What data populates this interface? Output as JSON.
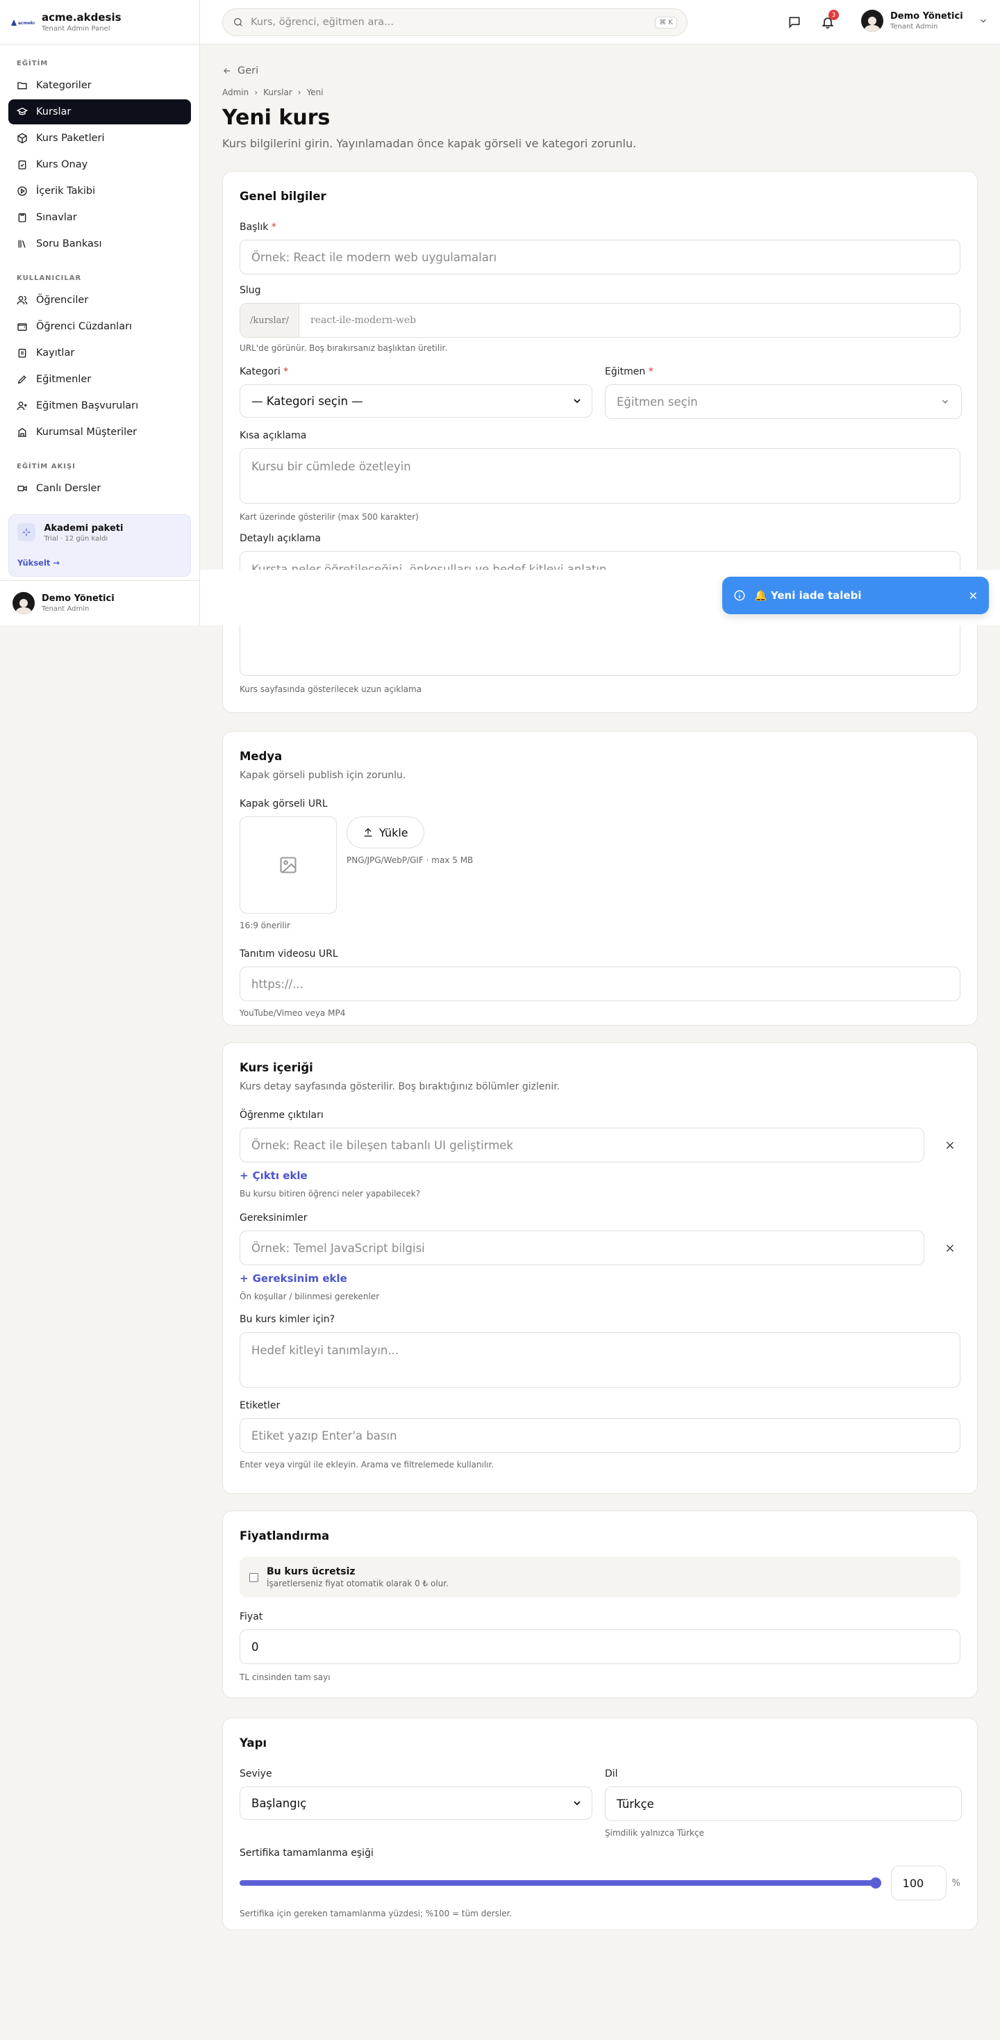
{
  "brand": {
    "logo": "acmekdx",
    "name": "acme.akdesis",
    "sub": "Tenant Admin Panel"
  },
  "sidebar": {
    "sections": [
      {
        "title": "EĞİTİM",
        "items": [
          {
            "label": "Kategoriler",
            "icon": "folder-icon"
          },
          {
            "label": "Kurslar",
            "icon": "graduation-cap-icon",
            "active": true
          },
          {
            "label": "Kurs Paketleri",
            "icon": "package-icon"
          },
          {
            "label": "Kurs Onay",
            "icon": "clipboard-check-icon"
          },
          {
            "label": "İçerik Takibi",
            "icon": "play-circle-icon"
          },
          {
            "label": "Sınavlar",
            "icon": "clipboard-icon"
          },
          {
            "label": "Soru Bankası",
            "icon": "library-icon"
          }
        ]
      },
      {
        "title": "KULLANICILAR",
        "items": [
          {
            "label": "Öğrenciler",
            "icon": "users-icon"
          },
          {
            "label": "Öğrenci Cüzdanları",
            "icon": "wallet-icon"
          },
          {
            "label": "Kayıtlar",
            "icon": "clipboard-list-icon"
          },
          {
            "label": "Eğitmenler",
            "icon": "pen-icon"
          },
          {
            "label": "Eğitmen Başvuruları",
            "icon": "user-plus-icon"
          },
          {
            "label": "Kurumsal Müşteriler",
            "icon": "building-icon"
          }
        ]
      },
      {
        "title": "EĞİTİM AKIŞI",
        "items": [
          {
            "label": "Canlı Dersler",
            "icon": "video-icon"
          }
        ]
      }
    ],
    "plan": {
      "title": "Akademi paketi",
      "sub": "Trial · 12 gün kaldı",
      "link": "Yükselt →"
    },
    "user": {
      "name": "Demo Yönetici",
      "role": "Tenant Admin"
    }
  },
  "topbar": {
    "search_placeholder": "Kurs, öğrenci, eğitmen ara...",
    "search_kbd": "⌘ K",
    "notif_count": "3",
    "user": {
      "name": "Demo Yönetici",
      "role": "Tenant Admin"
    }
  },
  "page": {
    "back": "Geri",
    "breadcrumb": [
      "Admin",
      "Kurslar",
      "Yeni"
    ],
    "title": "Yeni kurs",
    "subtitle": "Kurs bilgilerini girin. Yayınlamadan önce kapak görseli ve kategori zorunlu."
  },
  "general": {
    "title": "Genel bilgiler",
    "title_label": "Başlık",
    "title_placeholder": "Örnek: React ile modern web uygulamaları",
    "slug_label": "Slug",
    "slug_prefix": "/kurslar/",
    "slug_placeholder": "react-ile-modern-web",
    "slug_hint": "URL'de görünür. Boş bırakırsanız başlıktan üretilir.",
    "category_label": "Kategori",
    "category_value": "— Kategori seçin —",
    "instructor_label": "Eğitmen",
    "instructor_placeholder": "Eğitmen seçin",
    "short_label": "Kısa açıklama",
    "short_placeholder": "Kursu bir cümlede özetleyin",
    "short_hint": "Kart üzerinde gösterilir (max 500 karakter)",
    "long_label": "Detaylı açıklama",
    "long_placeholder": "Kursta neler öğretileceğini, önkoşulları ve hedef kitleyi anlatın...",
    "long_hint": "Kurs sayfasında gösterilecek uzun açıklama"
  },
  "media": {
    "title": "Medya",
    "desc": "Kapak görseli publish için zorunlu.",
    "cover_label": "Kapak görseli URL",
    "upload": "Yükle",
    "upload_hint": "PNG/JPG/WebP/GIF · max 5 MB",
    "ratio_hint": "16:9 önerilir",
    "video_label": "Tanıtım videosu URL",
    "video_placeholder": "https://...",
    "video_hint": "YouTube/Vimeo veya MP4"
  },
  "content": {
    "title": "Kurs içeriği",
    "desc": "Kurs detay sayfasında gösterilir. Boş bıraktığınız bölümler gizlenir.",
    "outcomes_label": "Öğrenme çıktıları",
    "outcomes_placeholder": "Örnek: React ile bileşen tabanlı UI geliştirmek",
    "outcomes_add": "Çıktı ekle",
    "outcomes_hint": "Bu kursu bitiren öğrenci neler yapabilecek?",
    "req_label": "Gereksinimler",
    "req_placeholder": "Örnek: Temel JavaScript bilgisi",
    "req_add": "Gereksinim ekle",
    "req_hint": "Ön koşullar / bilinmesi gerekenler",
    "audience_label": "Bu kurs kimler için?",
    "audience_placeholder": "Hedef kitleyi tanımlayın...",
    "tags_label": "Etiketler",
    "tags_placeholder": "Etiket yazıp Enter'a basın",
    "tags_hint": "Enter veya virgül ile ekleyin. Arama ve filtrelemede kullanılır."
  },
  "pricing": {
    "title": "Fiyatlandırma",
    "free_label": "Bu kurs ücretsiz",
    "free_hint": "İşaretlerseniz fiyat otomatik olarak 0 ₺ olur.",
    "price_label": "Fiyat",
    "price_value": "0",
    "price_hint": "TL cinsinden tam sayı"
  },
  "structure": {
    "title": "Yapı",
    "level_label": "Seviye",
    "level_value": "Başlangıç",
    "lang_label": "Dil",
    "lang_value": "Türkçe",
    "lang_hint": "Şimdilik yalnızca Türkçe",
    "cert_label": "Sertifika tamamlanma eşiği",
    "cert_value": "100",
    "cert_unit": "%",
    "cert_hint": "Sertifika için gereken tamamlanma yüzdesi; %100 = tüm dersler."
  },
  "toast": {
    "text": "🔔 Yeni iade talebi"
  },
  "colors": {
    "accent": "#4b55c9",
    "active_nav": "#0d0f1a",
    "toast": "#3d8ef2",
    "required": "#d23333"
  }
}
